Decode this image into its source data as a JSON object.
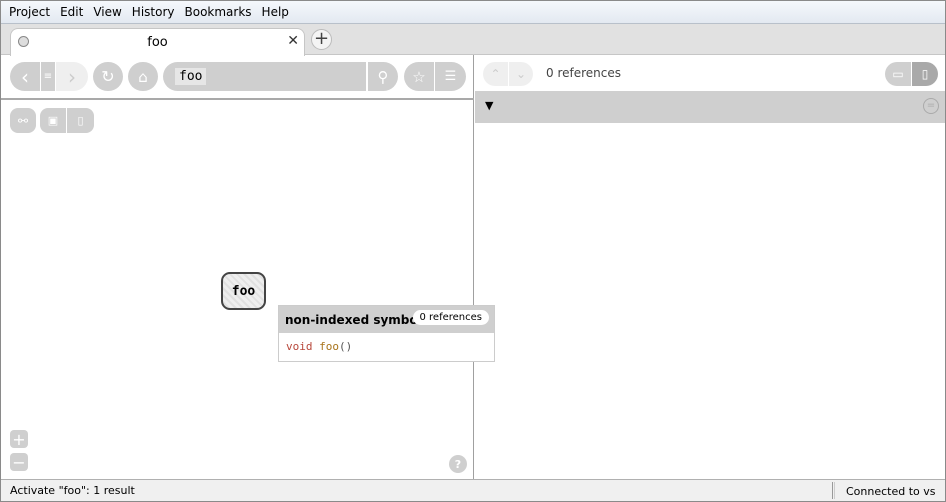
{
  "menu": [
    "Project",
    "Edit",
    "View",
    "History",
    "Bookmarks",
    "Help"
  ],
  "tab": {
    "title": "foo"
  },
  "search": {
    "value": "foo"
  },
  "graph": {
    "node_label": "foo",
    "tooltip": {
      "title": "non-indexed symbol",
      "badge": "0 references",
      "code_keyword": "void",
      "code_name": "foo",
      "code_parens": "()"
    }
  },
  "references": {
    "count_label": "0 references"
  },
  "status": {
    "left": "Activate \"foo\": 1 result",
    "right": "Connected to vs"
  }
}
